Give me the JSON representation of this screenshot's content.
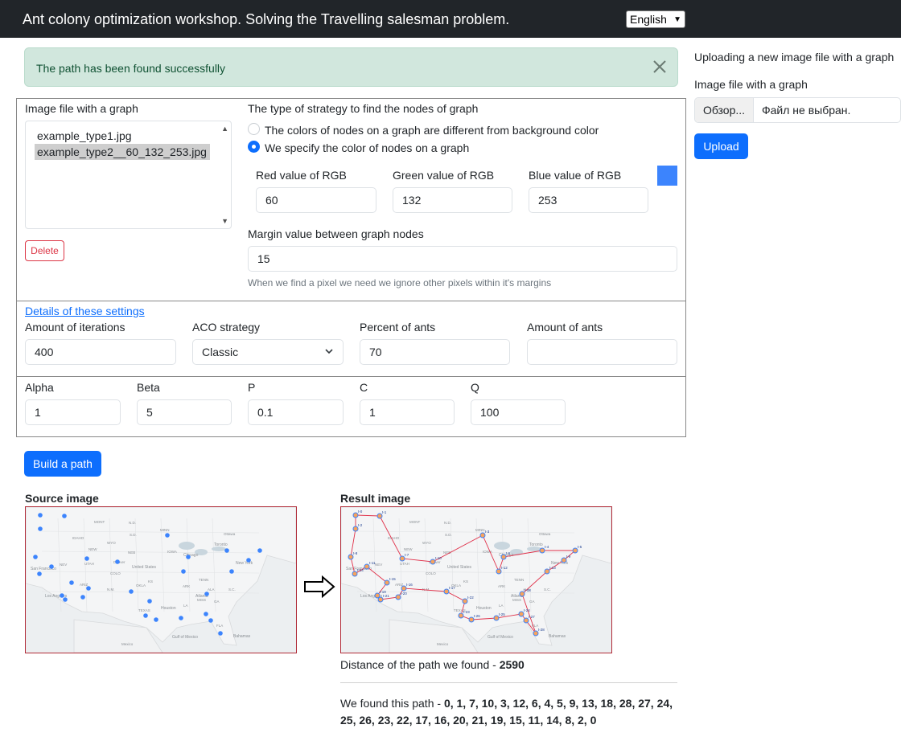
{
  "header": {
    "title": "Ant colony optimization workshop. Solving the Travelling salesman problem.",
    "language": "English"
  },
  "alert": {
    "message": "The path has been found successfully"
  },
  "image_panel": {
    "label": "Image file with a graph",
    "files": [
      "example_type1.jpg",
      "example_type2__60_132_253.jpg"
    ],
    "selected_index": 1,
    "delete_label": "Delete"
  },
  "strategy": {
    "label": "The type of strategy to find the nodes of graph",
    "options": [
      "The colors of nodes on a graph are different from background color",
      "We specify the color of nodes on a graph"
    ],
    "selected_index": 1,
    "red_label": "Red value of RGB",
    "green_label": "Green value of RGB",
    "blue_label": "Blue value of RGB",
    "red": "60",
    "green": "132",
    "blue": "253",
    "swatch_color": "#3c84fd",
    "margin_label": "Margin value between graph nodes",
    "margin": "15",
    "margin_help": "When we find a pixel we need we ignore other pixels within it's margins"
  },
  "settings": {
    "details_link": "Details of these settings",
    "iterations_label": "Amount of iterations",
    "iterations": "400",
    "aco_label": "ACO strategy",
    "aco": "Classic",
    "percent_label": "Percent of ants",
    "percent": "70",
    "ants_label": "Amount of ants",
    "ants": ""
  },
  "params": {
    "alpha_label": "Alpha",
    "alpha": "1",
    "beta_label": "Beta",
    "beta": "5",
    "p_label": "P",
    "p": "0.1",
    "c_label": "C",
    "c": "1",
    "q_label": "Q",
    "q": "100"
  },
  "build_label": "Build a path",
  "source_title": "Source image",
  "result_title": "Result image",
  "map_labels": [
    "United States",
    "Mexico",
    "Gulf of Mexico",
    "Bahamas",
    "Ottawa",
    "Toronto",
    "New York",
    "Chicago",
    "Denver",
    "NEW",
    "KS",
    "ARK",
    "ALA",
    "OKLA",
    "TENN",
    "IOWA",
    "Atlanta",
    "Houston",
    "San Francisco",
    "Los Angeles",
    "N.D.",
    "S.D.",
    "MINN",
    "WYO",
    "NEB",
    "MONT",
    "IDAHO",
    "NEV",
    "UTAH",
    "COLO",
    "ARIZ",
    "N.M.",
    "TEXAS",
    "LA",
    "MISS",
    "GA",
    "FLA",
    "S.C."
  ],
  "result": {
    "distance_label": "Distance of the path we found - ",
    "distance": "2590",
    "path_label": "We found this path - ",
    "path": "0, 1, 7, 10, 3, 12, 6, 4, 5, 9, 13, 18, 28, 27, 24, 25, 26, 23, 22, 17, 16, 20, 21, 19, 15, 11, 14, 8, 2, 0"
  },
  "upload": {
    "title": "Uploading a new image file with a graph",
    "label": "Image file with a graph",
    "browse": "Обзор...",
    "no_file": "Файл не выбран.",
    "upload_label": "Upload"
  },
  "colors": {
    "node": "#3c84fd",
    "path": "#e0314a",
    "primary": "#0d6efd",
    "danger": "#dc3545"
  }
}
